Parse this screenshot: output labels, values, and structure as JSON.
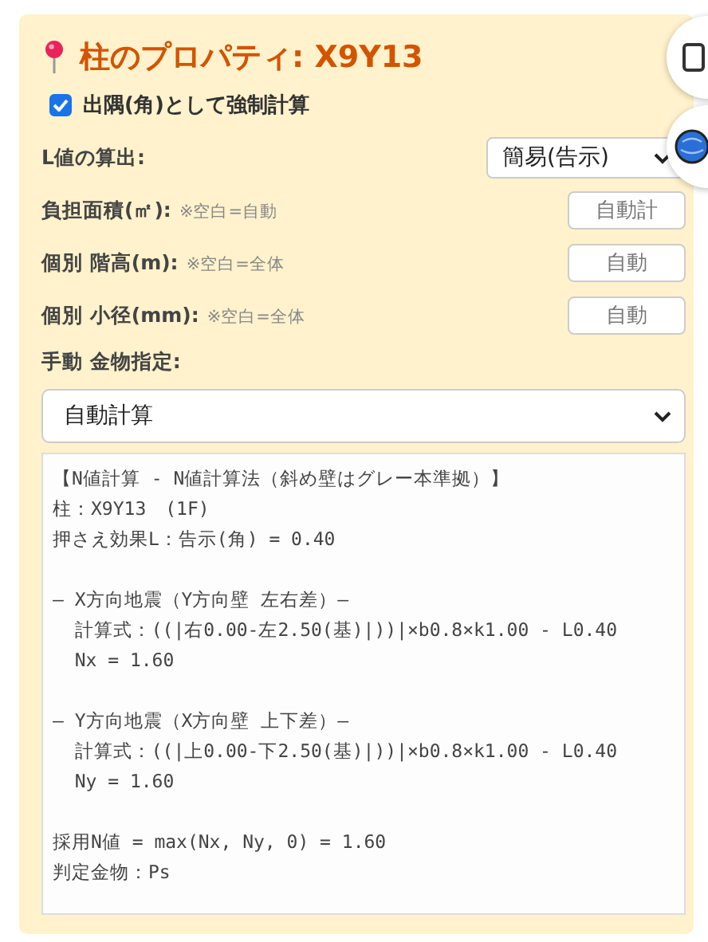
{
  "panel": {
    "title": "柱のプロパティ: X9Y13",
    "checkbox": {
      "label": "出隅(角)として強制計算",
      "checked": true
    },
    "fields": [
      {
        "kind": "select",
        "label": "L値の算出:",
        "value": "簡易(告示)"
      },
      {
        "kind": "input",
        "label": "負担面積(㎡):",
        "note": "※空白=自動",
        "placeholder": "自動計"
      },
      {
        "kind": "input",
        "label": "個別 階高(m):",
        "note": "※空白=全体",
        "placeholder": "自動"
      },
      {
        "kind": "input",
        "label": "個別 小径(mm):",
        "note": "※空白=全体",
        "placeholder": "自動"
      }
    ],
    "hardware": {
      "label": "手動 金物指定:",
      "value": "自動計算"
    },
    "output": [
      [
        "【N値計算 - N値計算法（斜め壁はグレー本準拠）】",
        "柱：X9Y13　(1F)",
        "押さえ効果L：告示(角) = 0.40"
      ],
      [
        "― X方向地震（Y方向壁 左右差）―",
        "  計算式：((|右0.00-左2.50(基)|))|×b0.8×k1.00 - L0.40",
        "  Nx = 1.60"
      ],
      [
        "― Y方向地震（X方向壁 上下差）―",
        "  計算式：((|上0.00-下2.50(基)|))|×b0.8×k1.00 - L0.40",
        "  Ny = 1.60"
      ],
      [
        "採用N値 = max(Nx, Ny, 0) = 1.60",
        "判定金物：Ps"
      ]
    ]
  }
}
